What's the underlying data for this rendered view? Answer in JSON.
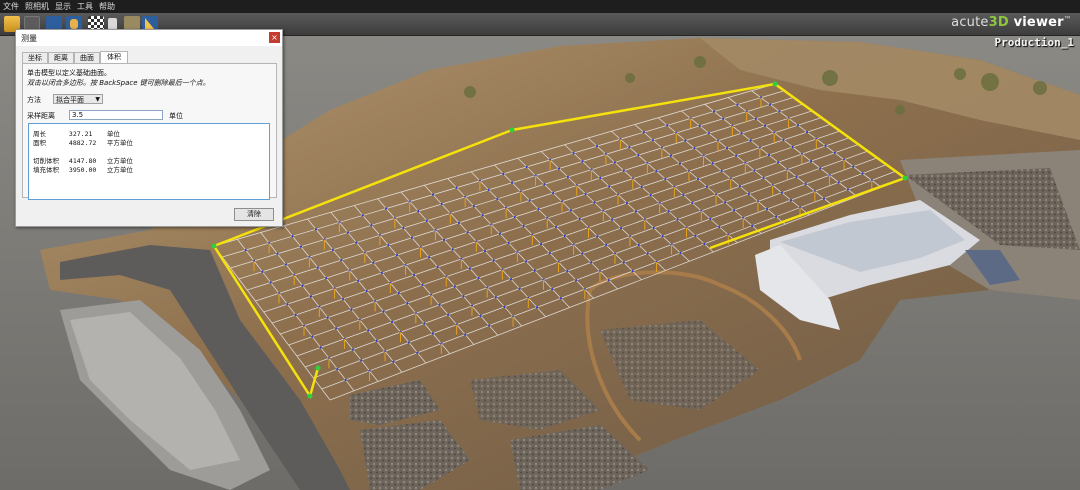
{
  "menu": [
    "文件",
    "照相机",
    "显示",
    "工具",
    "帮助"
  ],
  "toolbar": {
    "icons": [
      "open-folder-icon",
      "refresh-icon",
      "select-arrow-icon",
      "pan-hand-icon",
      "checker-pattern-icon",
      "camera-icon",
      "layers-icon",
      "measure-ruler-icon"
    ]
  },
  "brand": {
    "prefix": "acute",
    "num": "3D",
    "suffix": " viewer",
    "tm": "™"
  },
  "viewport_title": "Production_1",
  "dialog": {
    "title": "测量",
    "close": "×",
    "tabs": [
      "坐标",
      "距离",
      "曲面",
      "体积"
    ],
    "active_tab": "体积",
    "instruction1": "单击模型以定义基础曲面。",
    "instruction2": "双击以闭合多边形。按 BackSpace 键可删除最后一个点。",
    "method_label": "方法",
    "method_value": "拟合平面",
    "sampling_label": "采样距离",
    "sampling_value": "3.5",
    "sampling_unit": "单位",
    "results": {
      "perimeter_label": "周长",
      "perimeter_value": "327.21",
      "perimeter_unit": "单位",
      "area_label": "面积",
      "area_value": "4882.72",
      "area_unit": "平方单位",
      "cut_label": "切削体积",
      "cut_value": "4147.80",
      "cut_unit": "立方单位",
      "fill_label": "填充体积",
      "fill_value": "3950.00",
      "fill_unit": "立方单位"
    },
    "clear_button": "清除"
  }
}
